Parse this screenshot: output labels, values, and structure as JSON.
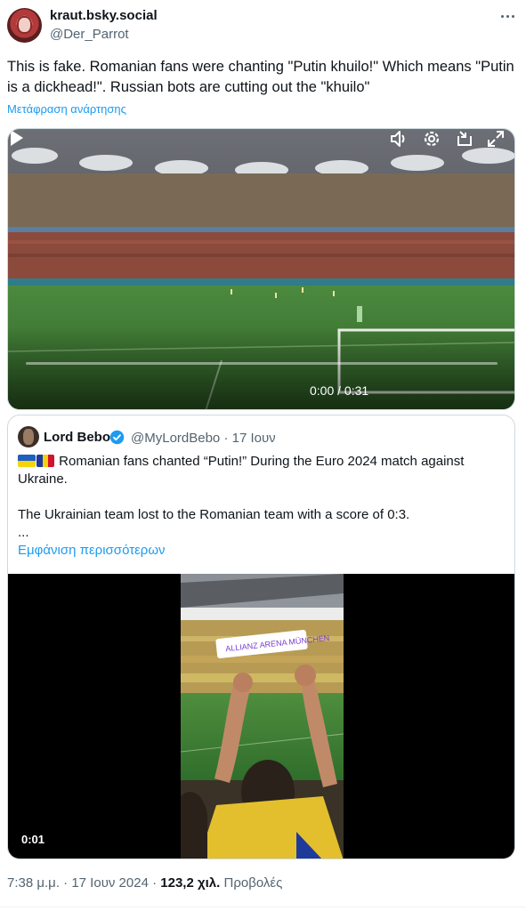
{
  "author": {
    "display_name": "kraut.bsky.social",
    "handle": "@Der_Parrot"
  },
  "tweet": {
    "text": "This is fake. Romanian fans were chanting \"Putin khuilo!\" Which means \"Putin is a dickhead!\". Russian bots are cutting out the \"khuilo\"",
    "translate_label": "Μετάφραση ανάρτησης"
  },
  "video": {
    "time": "0:00 / 0:31",
    "progress": 0.0
  },
  "quote": {
    "author_name": "Lord Bebo",
    "handle_and_date": "@MyLordBebo · 17 Ιουν",
    "line1": "Romanian fans chanted “Putin!” During the Euro 2024 match against",
    "line2": "Ukraine.",
    "line3": "The Ukrainian team lost to the Romanian team with a score of 0:3.",
    "line4": "...",
    "show_more": "Εμφάνιση περισσότερων",
    "video_time": "0:01",
    "sticker_text": "ALLIANZ ARENA MÜNCHEN"
  },
  "meta": {
    "time": "7:38 μ.μ.",
    "date": "17 Ιουν 2024",
    "views": "123,2 χιλ.",
    "views_label": "Προβολές"
  },
  "colors": {
    "accent": "#1d9bf0",
    "secondary_text": "#536471",
    "pitch_green": "#3f7a34"
  },
  "icons": [
    "more-icon",
    "play-icon",
    "volume-icon",
    "settings-icon",
    "pip-icon",
    "fullscreen-icon",
    "verified-icon",
    "ukraine-flag-icon",
    "romania-flag-icon"
  ]
}
